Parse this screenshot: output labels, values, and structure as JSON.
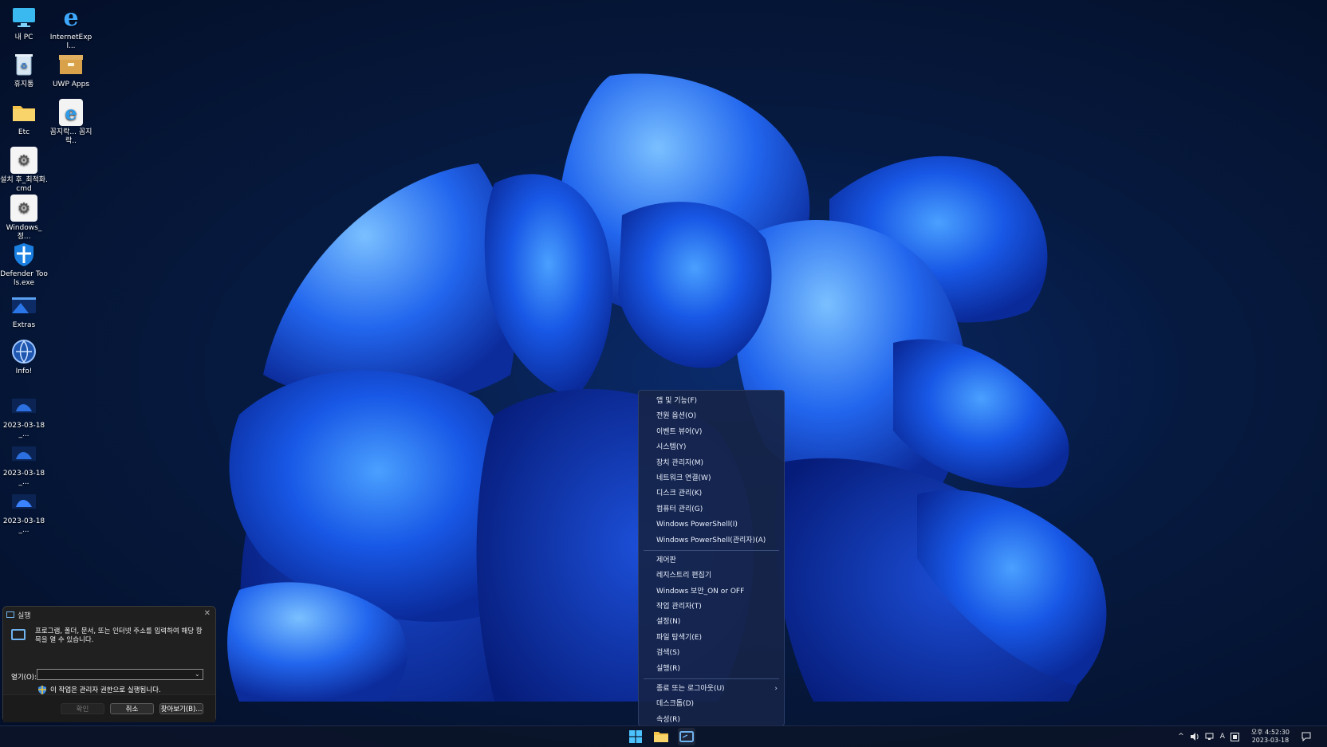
{
  "desktop": {
    "icons": [
      {
        "label": "내 PC",
        "icon": "monitor-icon"
      },
      {
        "label": "InternetExpl...",
        "icon": "internet-explorer-icon"
      },
      {
        "label": "휴지통",
        "icon": "recycle-bin-icon"
      },
      {
        "label": "UWP Apps",
        "icon": "archive-box-icon"
      },
      {
        "label": "Etc",
        "icon": "folder-icon"
      },
      {
        "label": "꼼지락... 꼼지락..",
        "icon": "internet-explorer-shortcut-icon"
      },
      {
        "label": "설치 후_최적화.cmd",
        "icon": "gear-script-icon"
      },
      {
        "label": "Windows_정...",
        "icon": "gear-script-icon"
      },
      {
        "label": "Defender Tools.exe",
        "icon": "shield-icon"
      },
      {
        "label": "Extras",
        "icon": "window-thumbnail-icon"
      },
      {
        "label": "Info!",
        "icon": "globe-icon"
      },
      {
        "label": "2023-03-18_...",
        "icon": "image-file-icon"
      },
      {
        "label": "2023-03-18_...",
        "icon": "image-file-icon"
      },
      {
        "label": "2023-03-18_...",
        "icon": "image-file-icon"
      }
    ]
  },
  "context_menu": {
    "group1": [
      "앱 및 기능(F)",
      "전원 옵션(O)",
      "이벤트 뷰어(V)",
      "시스템(Y)",
      "장치 관리자(M)",
      "네트워크 연결(W)",
      "디스크 관리(K)",
      "컴퓨터 관리(G)",
      "Windows PowerShell(I)",
      "Windows PowerShell(관리자)(A)"
    ],
    "group2": [
      "제어판",
      "레지스트리 편집기",
      "Windows 보안_ON or OFF",
      "작업 관리자(T)",
      "설정(N)",
      "파일 탐색기(E)",
      "검색(S)",
      "실행(R)"
    ],
    "group3": [
      "종료 또는 로그아웃(U)",
      "데스크톱(D)"
    ],
    "group4": [
      "속성(R)"
    ],
    "submenu_arrow": "›"
  },
  "run_dialog": {
    "title": "실행",
    "close_glyph": "✕",
    "description": "프로그램, 폴더, 문서, 또는 인터넷 주소를 입력하여 해당 항목을 열 수 있습니다.",
    "open_label": "열기(O):",
    "open_value": "",
    "admin_note": "이 작업은 관리자 권한으로 실행됩니다.",
    "ok_label": "확인",
    "cancel_label": "취소",
    "browse_label": "찾아보기(B)..."
  },
  "taskbar": {
    "tray": {
      "chevron": "^",
      "input_indicator": "A",
      "time": "오후 4:52:30",
      "date": "2023-03-18"
    }
  },
  "colors": {
    "accent": "#0a5cff",
    "desktop_bg": "#061a40",
    "menu_bg": "#16244a"
  }
}
